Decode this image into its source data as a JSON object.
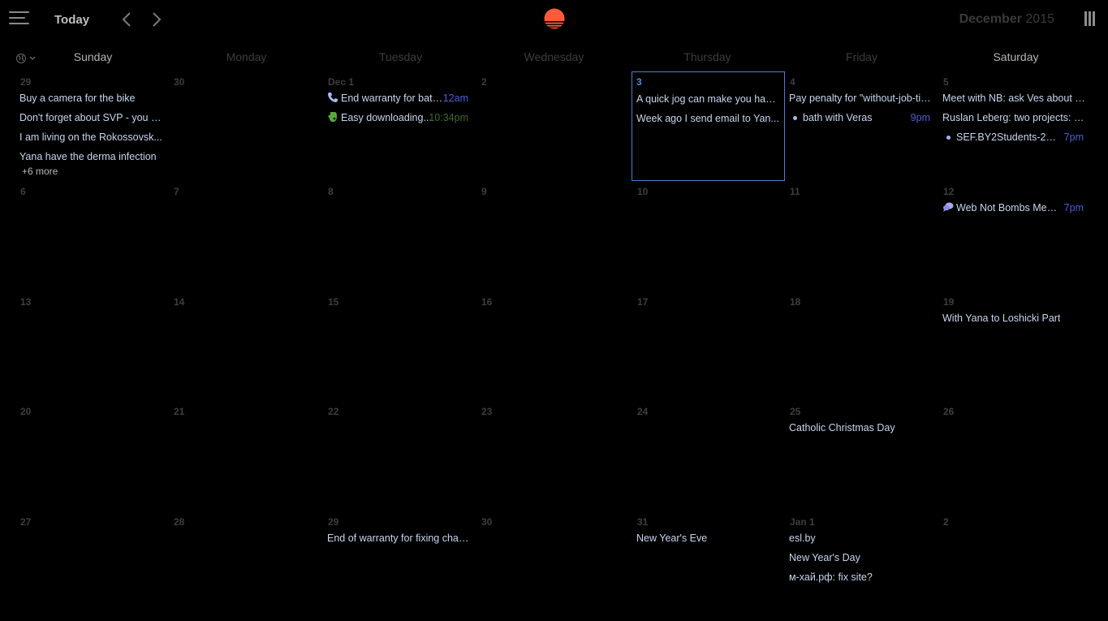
{
  "toolbar": {
    "today_label": "Today",
    "month": "December",
    "year": "2015",
    "logo_color": "#ff5a3c"
  },
  "weekdays": [
    "Sunday",
    "Monday",
    "Tuesday",
    "Wednesday",
    "Thursday",
    "Friday",
    "Saturday"
  ],
  "weeks": [
    [
      {
        "label": "29",
        "events": [
          {
            "title": "Buy a camera for the bike"
          },
          {
            "title": "Don't forget about SVP - you m..."
          },
          {
            "title": "I am living on the Rokossovsk..."
          },
          {
            "title": "Yana have the derma infection"
          }
        ],
        "more": "+6 more"
      },
      {
        "label": "30",
        "events": []
      },
      {
        "label": "Dec 1",
        "events": [
          {
            "title": "End warranty for batte...",
            "time": "12am",
            "icon": "phone-icon"
          },
          {
            "title": "Easy downloading...",
            "time": "10:34pm",
            "icon": "evernote-icon",
            "time_color": "green"
          }
        ]
      },
      {
        "label": "2",
        "events": []
      },
      {
        "label": "3",
        "today": true,
        "events": [
          {
            "title": "A quick jog can make you happ..."
          },
          {
            "title": "Week ago I send email to Yan..."
          }
        ]
      },
      {
        "label": "4",
        "events": [
          {
            "title": "Pay penalty for \"without-job-tim..."
          },
          {
            "title": "bath with Veras",
            "time": "9pm",
            "dot": true
          }
        ]
      },
      {
        "label": "5",
        "events": [
          {
            "title": "Meet with NB: ask Ves about ti..."
          },
          {
            "title": "Ruslan Leberg: two projects: s..."
          },
          {
            "title": "SEF.BY2Students-2015",
            "time": "7pm",
            "dot": true
          }
        ]
      }
    ],
    [
      {
        "label": "6",
        "events": []
      },
      {
        "label": "7",
        "events": []
      },
      {
        "label": "8",
        "events": []
      },
      {
        "label": "9",
        "events": []
      },
      {
        "label": "10",
        "events": []
      },
      {
        "label": "11",
        "events": []
      },
      {
        "label": "12",
        "events": [
          {
            "title": "Web Not Bombs Meet...",
            "time": "7pm",
            "icon": "chat-icon"
          }
        ]
      }
    ],
    [
      {
        "label": "13",
        "events": []
      },
      {
        "label": "14",
        "events": []
      },
      {
        "label": "15",
        "events": []
      },
      {
        "label": "16",
        "events": []
      },
      {
        "label": "17",
        "events": []
      },
      {
        "label": "18",
        "events": []
      },
      {
        "label": "19",
        "events": [
          {
            "title": "With Yana to Loshicki Part"
          }
        ]
      }
    ],
    [
      {
        "label": "20",
        "events": []
      },
      {
        "label": "21",
        "events": []
      },
      {
        "label": "22",
        "events": []
      },
      {
        "label": "23",
        "events": []
      },
      {
        "label": "24",
        "events": []
      },
      {
        "label": "25",
        "events": [
          {
            "title": "Catholic Christmas Day"
          }
        ]
      },
      {
        "label": "26",
        "events": []
      }
    ],
    [
      {
        "label": "27",
        "events": []
      },
      {
        "label": "28",
        "events": []
      },
      {
        "label": "29",
        "events": [
          {
            "title": "End of warranty for fixing charg..."
          }
        ]
      },
      {
        "label": "30",
        "events": []
      },
      {
        "label": "31",
        "events": [
          {
            "title": "New Year's Eve"
          }
        ]
      },
      {
        "label": "Jan 1",
        "events": [
          {
            "title": "esl.by"
          },
          {
            "title": "New Year's Day"
          },
          {
            "title": "м-хай.рф: fix site?"
          }
        ]
      },
      {
        "label": "2",
        "events": []
      }
    ]
  ]
}
